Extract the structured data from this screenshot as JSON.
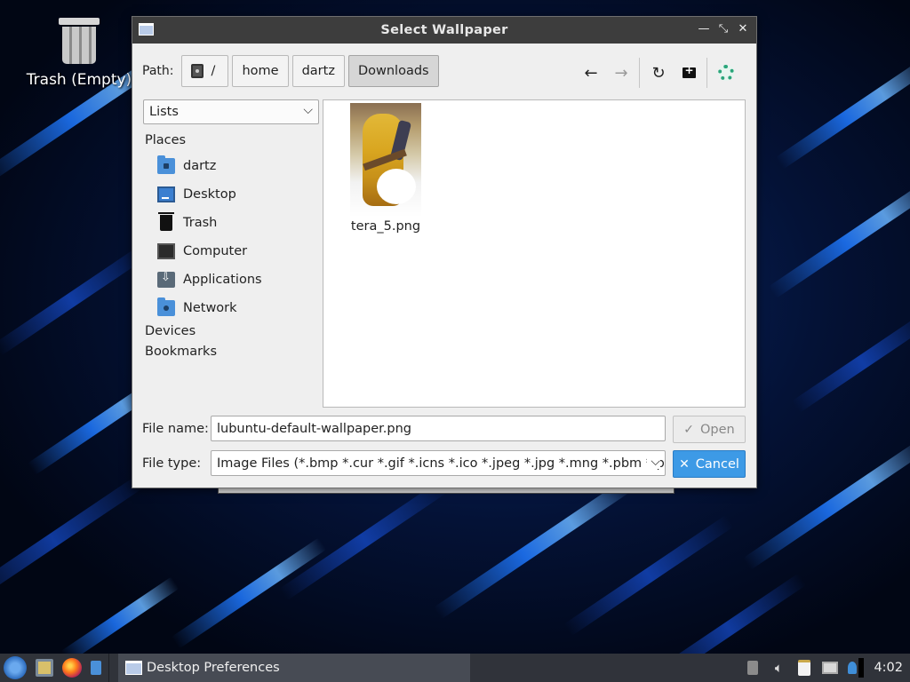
{
  "desktop": {
    "trash_label": "Trash (Empty)"
  },
  "dialog": {
    "title": "Select Wallpaper",
    "controls": {
      "shade": "—",
      "restore": "⤡",
      "close": "✕"
    },
    "path": {
      "label": "Path:",
      "root": "/",
      "crumbs": [
        "home",
        "dartz",
        "Downloads"
      ],
      "active": "Downloads"
    },
    "toolbar": {
      "back": "←",
      "forward": "→",
      "reload": "↻",
      "new_folder": "+"
    },
    "sidebar": {
      "combo_value": "Lists",
      "places_header": "Places",
      "places": [
        "dartz",
        "Desktop",
        "Trash",
        "Computer",
        "Applications",
        "Network"
      ],
      "devices_header": "Devices",
      "bookmarks_header": "Bookmarks"
    },
    "files": [
      {
        "name": "tera_5.png"
      }
    ],
    "filename": {
      "label": "File name:",
      "value": "lubuntu-default-wallpaper.png"
    },
    "filetype": {
      "label": "File type:",
      "value": "Image Files (*.bmp *.cur *.gif *.icns *.ico *.jpeg *.jpg *.mng *.pbm *.pgm"
    },
    "buttons": {
      "open": "Open",
      "cancel": "Cancel"
    }
  },
  "taskbar": {
    "task_title": "Desktop Preferences",
    "clock": "4:02"
  },
  "colors": {
    "titlebar": "#3d3d3d",
    "accent_button": "#3d9ae6",
    "taskbar": "#30333a"
  }
}
